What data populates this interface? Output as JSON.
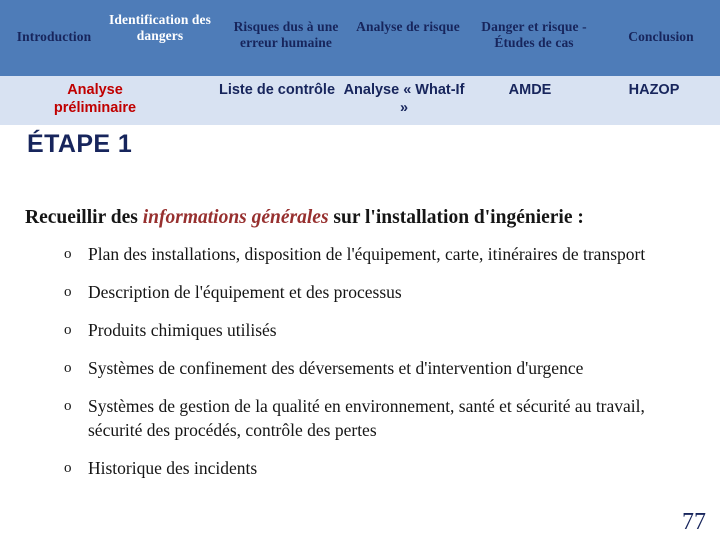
{
  "nav_primary": {
    "background_color": "#4e7cb8",
    "items": [
      {
        "label": "Introduction",
        "active": false
      },
      {
        "label": "Identification des dangers",
        "active": true
      },
      {
        "label": "Risques dus à une erreur humaine",
        "active": false
      },
      {
        "label": "Analyse de risque",
        "active": false
      },
      {
        "label": "Danger et risque - Études de cas",
        "active": false
      },
      {
        "label": "Conclusion",
        "active": false
      }
    ]
  },
  "nav_secondary": {
    "background_color": "#d8e2f2",
    "active_color": "#c00000",
    "items": [
      {
        "label": "Analyse préliminaire",
        "active": true
      },
      {
        "label": "Liste de contrôle",
        "active": false
      },
      {
        "label": "Analyse « What-If »",
        "active": false
      },
      {
        "label": "AMDE",
        "active": false
      },
      {
        "label": "HAZOP",
        "active": false
      }
    ]
  },
  "slide": {
    "title": "ÉTAPE 1",
    "title_color": "#17255c",
    "lead": {
      "before": "Recueillir des ",
      "emphasis": "informations générales",
      "emphasis_color": "#97302f",
      "after": " sur l'installation d'ingénierie :"
    },
    "bullet_marker": "o",
    "bullets": [
      "Plan des installations, disposition de l'équipement, carte, itinéraires de transport",
      "Description de l'équipement et des processus",
      "Produits chimiques utilisés",
      "Systèmes de confinement des déversements et d'intervention d'urgence",
      "Systèmes de gestion de la qualité en environnement, santé et sécurité au travail, sécurité des procédés, contrôle des pertes",
      "Historique des incidents"
    ]
  },
  "footer": {
    "page_number": "77"
  }
}
